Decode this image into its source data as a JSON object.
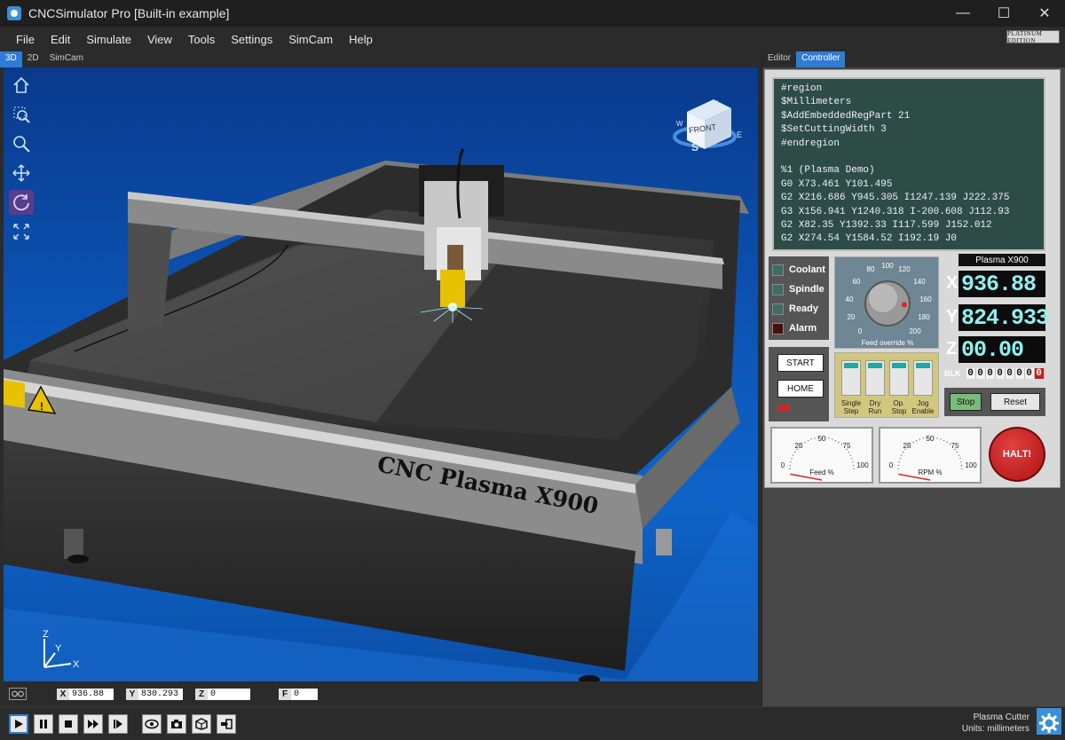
{
  "window": {
    "title": "CNCSimulator Pro [Built-in example]",
    "minimize": "—",
    "maximize": "☐",
    "close": "✕"
  },
  "menu": [
    "File",
    "Edit",
    "Simulate",
    "View",
    "Tools",
    "Settings",
    "SimCam",
    "Help"
  ],
  "edition_badge": "PLATINUM EDITION",
  "view_tabs": [
    "3D",
    "2D",
    "SimCam"
  ],
  "active_view_tab": "3D",
  "right_tabs": [
    "Editor",
    "Controller"
  ],
  "active_right_tab": "Controller",
  "scene": {
    "machine_label": "CNC Plasma X900",
    "cube_face": "FRONT",
    "compass": {
      "s": "S",
      "e": "E",
      "w": "W",
      "n": "N"
    },
    "axes": {
      "x": "X",
      "y": "Y",
      "z": "Z"
    }
  },
  "view_tools": [
    {
      "name": "home-view-icon"
    },
    {
      "name": "zoom-window-icon"
    },
    {
      "name": "zoom-icon"
    },
    {
      "name": "pan-icon"
    },
    {
      "name": "rotate-icon",
      "selected": true
    },
    {
      "name": "fit-view-icon"
    }
  ],
  "status": {
    "x_label": "X",
    "x_value": "936.88",
    "y_label": "Y",
    "y_value": "830.293",
    "z_label": "Z",
    "z_value": "0",
    "f_label": "F",
    "f_value": "0"
  },
  "code_lines": [
    "#region",
    "$Millimeters",
    "$AddEmbeddedRegPart 21",
    "$SetCuttingWidth 3",
    "#endregion",
    "",
    "%1 (Plasma Demo)",
    "G0 X73.461 Y101.495",
    "G2 X216.686 Y945.305 I1247.139 J222.375",
    "G3 X156.941 Y1240.318 I-200.608 J112.93",
    "G2 X82.35 Y1392.33 I117.599 J152.012",
    "G2 X274.54 Y1584.52 I192.19 J0"
  ],
  "leds": [
    {
      "label": "Coolant"
    },
    {
      "label": "Spindle"
    },
    {
      "label": "Ready"
    },
    {
      "label": "Alarm"
    }
  ],
  "buttons": {
    "start": "START",
    "home": "HOME",
    "stop": "Stop",
    "reset": "Reset",
    "halt": "HALT!"
  },
  "feed_override": {
    "label": "Feed override %",
    "ticks": [
      "0",
      "20",
      "40",
      "60",
      "80",
      "100",
      "120",
      "140",
      "160",
      "180",
      "200"
    ],
    "value_percent": 170
  },
  "switches": [
    {
      "label_1": "Single",
      "label_2": "Step"
    },
    {
      "label_1": "Dry",
      "label_2": "Run"
    },
    {
      "label_1": "Op.",
      "label_2": "Stop"
    },
    {
      "label_1": "Jog",
      "label_2": "Enable"
    }
  ],
  "dro": {
    "machine": "Plasma X900",
    "x_label": "X",
    "x": "936.88",
    "y_label": "Y",
    "y": "824.933",
    "z_label": "Z",
    "z": "00.00"
  },
  "blk": {
    "label": "BLK",
    "digits": [
      "0",
      "0",
      "0",
      "0",
      "0",
      "0",
      "0"
    ],
    "last_digit": "0"
  },
  "gauges": [
    {
      "title": "Feed %",
      "ticks": [
        "0",
        "25",
        "50",
        "75",
        "100"
      ],
      "value_percent": 0
    },
    {
      "title": "RPM %",
      "ticks": [
        "0",
        "25",
        "50",
        "75",
        "100"
      ],
      "value_percent": 0
    }
  ],
  "machine_info": {
    "type": "Plasma Cutter",
    "units": "Units: millimeters"
  },
  "colors": {
    "accent": "#2f7bd6",
    "code_bg": "#2e4c46",
    "dro_text": "#8ef0f0",
    "halt": "#c41e1e"
  }
}
